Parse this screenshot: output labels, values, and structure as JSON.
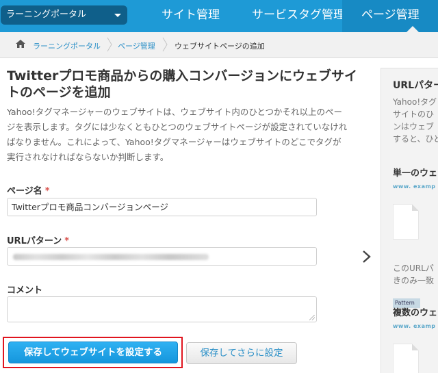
{
  "header": {
    "portal_select": "ラーニングポータル",
    "nav": {
      "site_manage": "サイト管理",
      "service_tag_manage": "サービスタグ管理",
      "page_manage": "ページ管理"
    }
  },
  "breadcrumb": {
    "portal": "ラーニングポータル",
    "page_manage": "ページ管理",
    "current": "ウェブサイトページの追加"
  },
  "main": {
    "title": "Twitterプロモ商品からの購入コンバージョンにウェブサイトのページを追加",
    "description": "Yahoo!タグマネージャーのウェブサイトは、ウェブサイト内のひとつかそれ以上のページを表示します。タグには少なくともひとつのウェブサイトページが設定されていなければなりません。これによって、Yahoo!タグマネージャーはウェブサイトのどこでタグが実行されなければならないか判断します。",
    "page_name_label": "ページ名",
    "page_name_value": "Twitterプロモ商品コンバージョンページ",
    "url_pattern_label": "URLパターン",
    "comment_label": "コメント",
    "required_mark": "*",
    "save_and_set_website_button": "保存してウェブサイトを設定する",
    "save_and_continue_button": "保存してさらに設定"
  },
  "side_panel": {
    "title": "URLパター",
    "description_lines": [
      "Yahoo!タグ",
      "サイトのひ",
      "ンはウェブ",
      "すると、ひと"
    ],
    "single_heading": "単一のウェ",
    "single_url": "www. examp le_",
    "pattern_tag": "Pattern",
    "note_lines": [
      "このURLパ",
      "きのみ一致"
    ],
    "multiple_heading": "複数のウェ",
    "multiple_url": "www. examp le_"
  },
  "colors": {
    "header_bg": "#1e9ad6",
    "portal_select_bg": "#0f5f8a",
    "link": "#2a8fc7",
    "primary_button": "#1596dc",
    "required": "#d9534f",
    "highlight_frame": "#e0141e"
  }
}
